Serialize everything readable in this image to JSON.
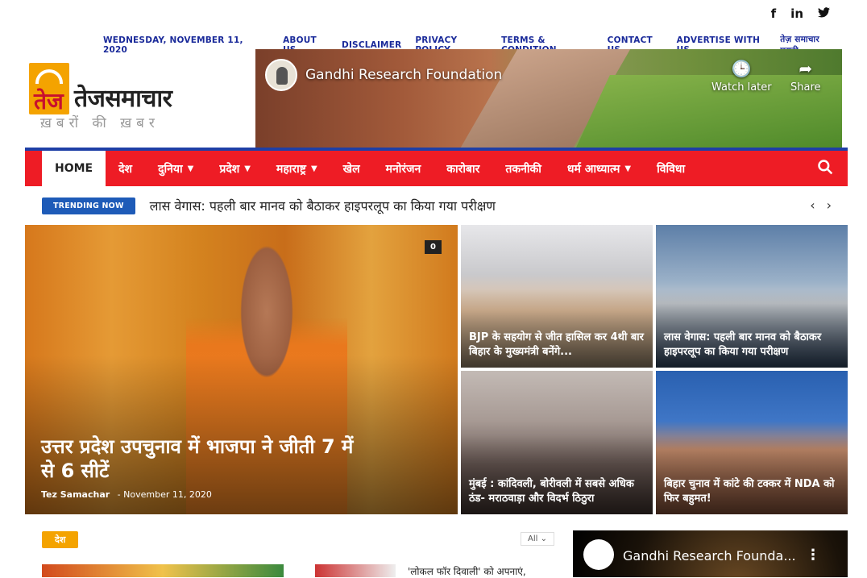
{
  "social": {
    "facebook": "f",
    "linkedin": "in",
    "twitter": "🐦"
  },
  "topbar": {
    "date": "WEDNESDAY, NOVEMBER 11, 2020",
    "links": [
      "ABOUT US",
      "DISCLAIMER",
      "PRIVACY POLICY",
      "TERMS & CONDITION",
      "CONTACT US",
      "ADVERTISE WITH US",
      "तेज़ समाचार मराठी"
    ]
  },
  "logo": {
    "name": "तेजसमाचार",
    "tagline": "ख़बरों की ख़बर",
    "mark": "तेज"
  },
  "header_video": {
    "channel": "Gandhi Research Foundation",
    "watch_later": "Watch later",
    "share": "Share"
  },
  "nav": {
    "items": [
      {
        "label": "HOME",
        "dropdown": false
      },
      {
        "label": "देश",
        "dropdown": false
      },
      {
        "label": "दुनिया",
        "dropdown": true
      },
      {
        "label": "प्रदेश",
        "dropdown": true
      },
      {
        "label": "महाराष्ट्र",
        "dropdown": true
      },
      {
        "label": "खेल",
        "dropdown": false
      },
      {
        "label": "मनोरंजन",
        "dropdown": false
      },
      {
        "label": "कारोबार",
        "dropdown": false
      },
      {
        "label": "तकनीकी",
        "dropdown": false
      },
      {
        "label": "धर्म आध्यात्म",
        "dropdown": true
      },
      {
        "label": "विविधा",
        "dropdown": false
      }
    ]
  },
  "trending": {
    "badge": "TRENDING NOW",
    "headline": "लास वेगास: पहली बार मानव को बैठाकर हाइपरलूप का किया गया परीक्षण",
    "prev": "‹",
    "next": "›"
  },
  "featured": {
    "title": "उत्तर प्रदेश उपचुनाव में भाजपा ने जीती 7 में से 6 सीटें",
    "author": "Tez Samachar",
    "sep": "-",
    "date": "November 11, 2020",
    "comments": "0"
  },
  "cards": [
    {
      "title": "BJP के सहयोग से जीत हासिल कर 4थी बार बिहार के मुख्यमंत्री बनेंगे..."
    },
    {
      "title": "लास वेगास: पहली बार मानव को बैठाकर हाइपरलूप का किया गया परीक्षण"
    },
    {
      "title": "मुंबई : कांदिवली, बोरीवली में सबसे अधिक ठंड- मराठवाड़ा और विदर्भ ठिठुरा"
    },
    {
      "title": "बिहार चुनाव में कांटे की टक्कर में NDA को फिर बहुमत!"
    }
  ],
  "section": {
    "category": "देश",
    "filter": "All",
    "filter_icon": "⌄",
    "snippet": "'लोकल फॉर दिवाली' को अपनाएं,"
  },
  "side_video": {
    "channel": "Gandhi Research Founda...",
    "menu": "⋮"
  }
}
